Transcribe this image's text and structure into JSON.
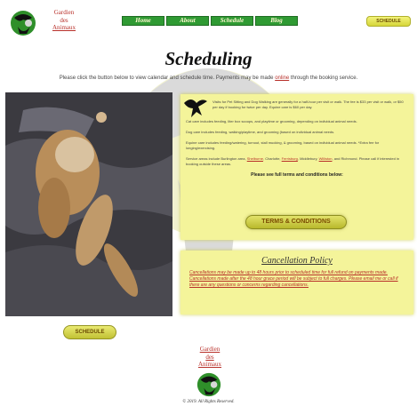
{
  "brand": {
    "line1": "Gardien",
    "line2": "des",
    "line3": "Animaux"
  },
  "nav": {
    "items": [
      {
        "label": "Home"
      },
      {
        "label": "About"
      },
      {
        "label": "Schedule"
      },
      {
        "label": "Blog"
      }
    ]
  },
  "header": {
    "schedule_button": "SCHEDULE"
  },
  "page": {
    "title": "Scheduling",
    "intro_before": "Please click the button below to view calendar and schedule time. Payments may be made ",
    "intro_link": "online",
    "intro_after": " through the booking service."
  },
  "info": {
    "p1": "Visits for Pet Sitting and Dog Walking are generally for a half-hour per visit or walk. The fee is $33 per visit or walk, or $50 per day if booking for twice per day. Equine care is $60 per day.",
    "p2": "Cat care includes feeding, liter box scoops, and playtime or grooming, depending on individual animal needs.",
    "p3": "Dog care includes feeding, walking/playtime, and grooming (based on individual animal needs.",
    "p4": "Equine care includes feeding/watering, turnout, stall mucking, & grooming, based on individual animal needs. *Extra fee for longing/exercising.",
    "p5_before": "Service areas include Burlington area, ",
    "p5_city1": "Shelburne",
    "p5_mid1": ", Charlotte, ",
    "p5_city2": "Ferrisburg",
    "p5_mid2": ", Middlebury, ",
    "p5_city3": "Williston",
    "p5_after": ", and Richmond. Please call if interested in booking outside these areas.",
    "see_terms": "Please see full terms and conditions below:",
    "terms_button": "TERMS & CONDITIONS"
  },
  "cancellation": {
    "title": "Cancellation Policy",
    "text": "Cancellations may be made up to 48 hours prior to scheduled time for full refund on payments made. Cancellations made after the 48 hour grace period will be subject to full charges. Please email me or call if there are any questions or concerns regarding cancellations."
  },
  "main_schedule_button": "SCHEDULE",
  "footer": {
    "brand": {
      "line1": "Gardien",
      "line2": "des",
      "line3": "Animaux"
    },
    "copyright": "© 2019. All Rights Reserved."
  },
  "colors": {
    "nav_green": "#2f9a33",
    "accent_red": "#b8302a",
    "panel_yellow": "#f4f49a",
    "button_yellow": "#d6d63a"
  },
  "icons": {
    "logo": "pets-globe-icon",
    "info": "griffin-bird-icon",
    "photo": "cat-photo"
  }
}
